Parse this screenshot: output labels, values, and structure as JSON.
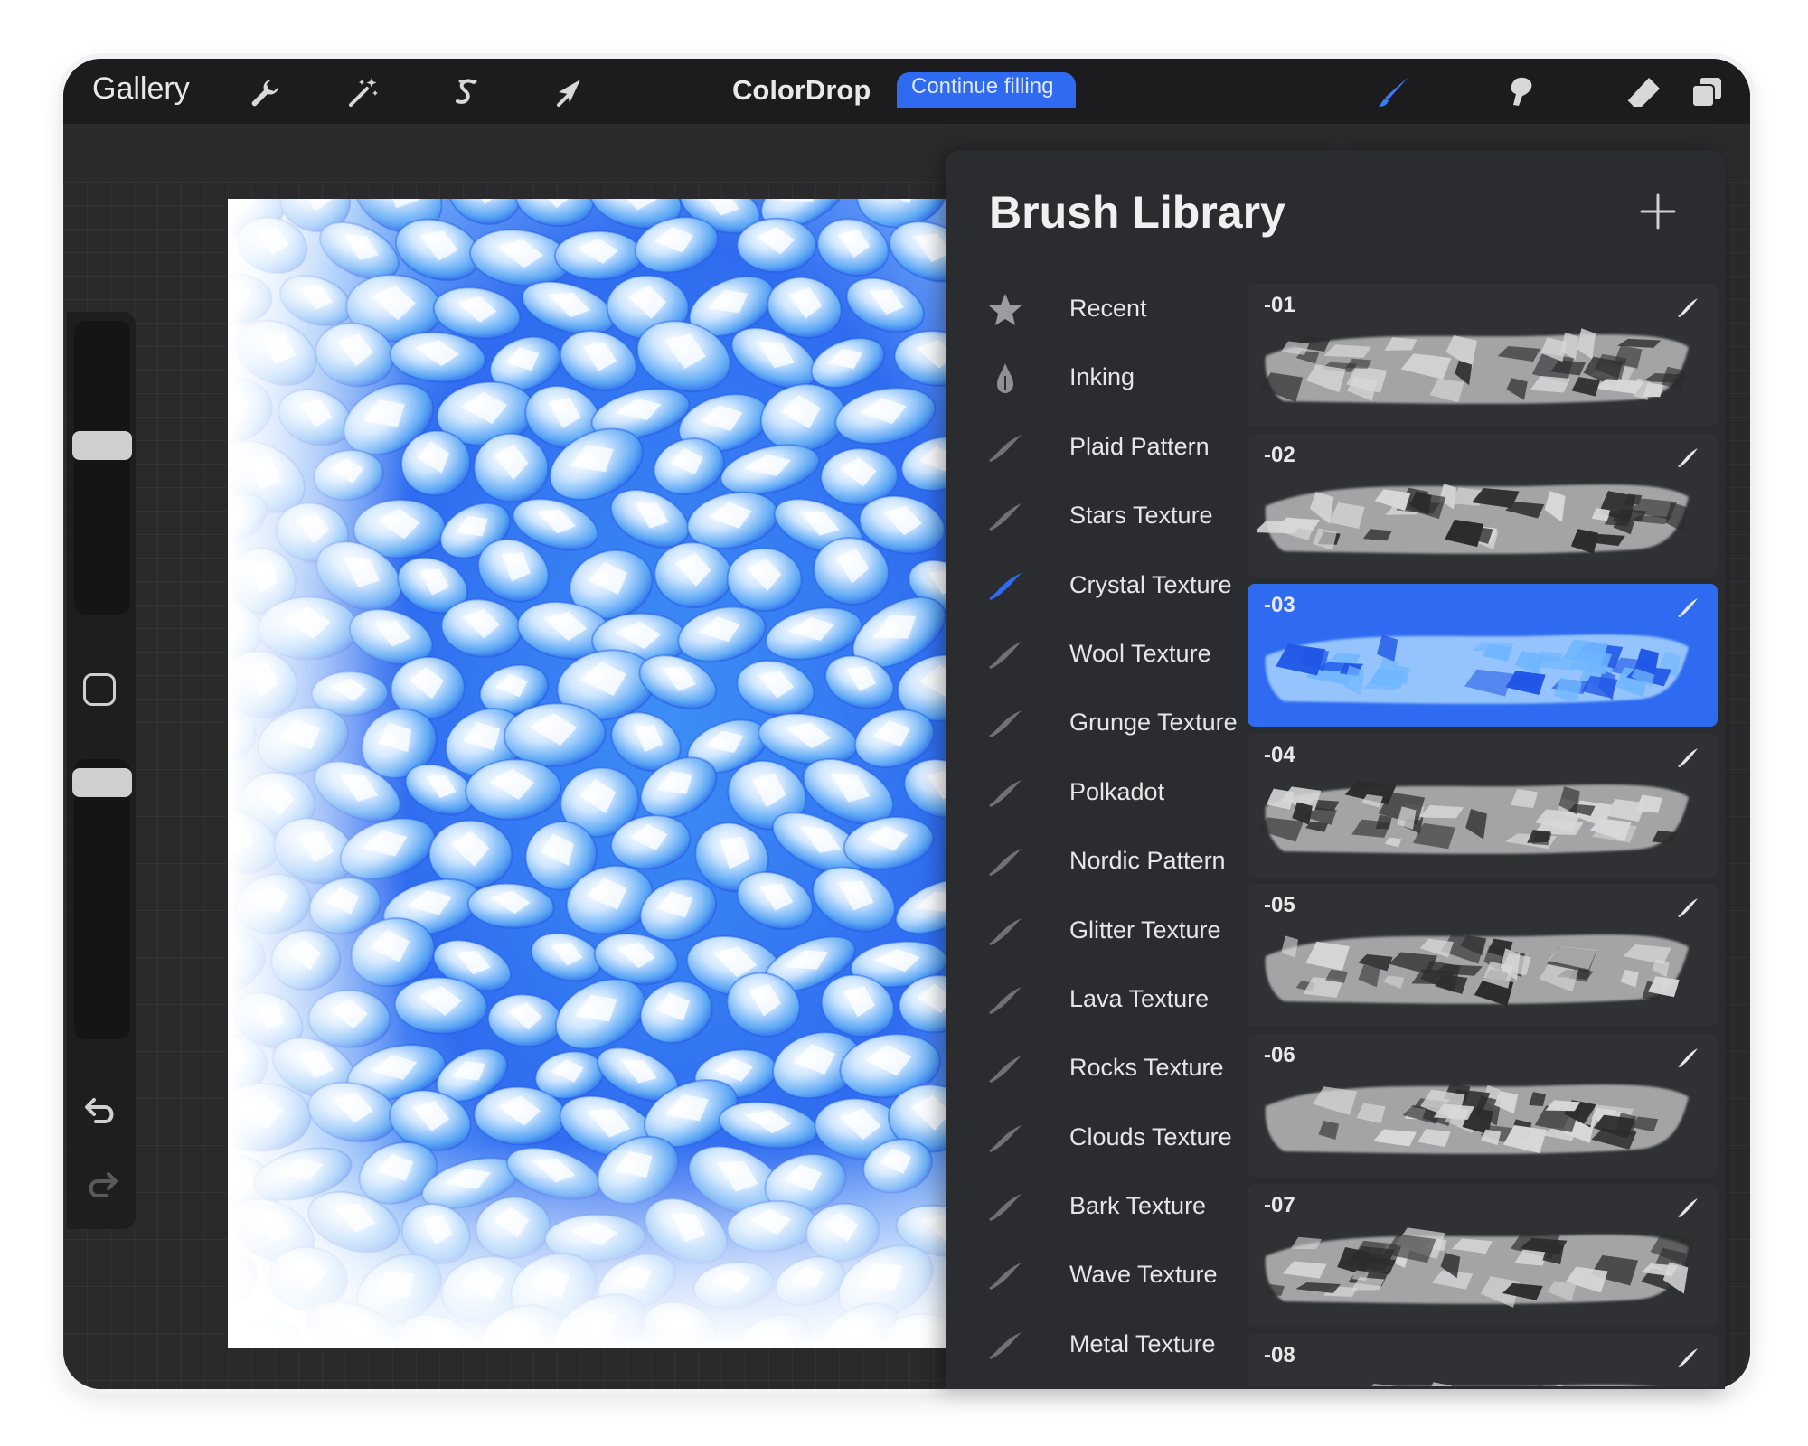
{
  "toolbar": {
    "gallery_label": "Gallery",
    "left_tools": [
      {
        "name": "actions",
        "icon": "wrench-icon"
      },
      {
        "name": "adjustments",
        "icon": "magic-wand-icon"
      },
      {
        "name": "selection",
        "icon": "selection-s-icon"
      },
      {
        "name": "transform",
        "icon": "arrow-cursor-icon"
      }
    ],
    "right_tools": [
      {
        "name": "paint",
        "icon": "brush-icon",
        "active": true
      },
      {
        "name": "smudge",
        "icon": "smudge-finger-icon",
        "active": false
      },
      {
        "name": "erase",
        "icon": "eraser-icon",
        "active": false
      },
      {
        "name": "layers",
        "icon": "layers-icon",
        "active": false
      }
    ]
  },
  "notification": {
    "title": "ColorDrop",
    "action_label": "Continue filling"
  },
  "brush_library": {
    "title": "Brush Library",
    "add_icon": "plus-icon",
    "sets": [
      {
        "label": "Recent",
        "icon": "star-icon"
      },
      {
        "label": "Inking",
        "icon": "ink-drop-icon"
      },
      {
        "label": "Plaid Pattern",
        "icon": "brush-stroke-icon"
      },
      {
        "label": "Stars Texture",
        "icon": "brush-stroke-icon"
      },
      {
        "label": "Crystal Texture",
        "icon": "brush-stroke-icon",
        "selected": true
      },
      {
        "label": "Wool Texture",
        "icon": "brush-stroke-icon"
      },
      {
        "label": "Grunge Texture",
        "icon": "brush-stroke-icon"
      },
      {
        "label": "Polkadot",
        "icon": "brush-stroke-icon"
      },
      {
        "label": "Nordic Pattern",
        "icon": "brush-stroke-icon"
      },
      {
        "label": "Glitter Texture",
        "icon": "brush-stroke-icon"
      },
      {
        "label": "Lava Texture",
        "icon": "brush-stroke-icon"
      },
      {
        "label": "Rocks Texture",
        "icon": "brush-stroke-icon"
      },
      {
        "label": "Clouds Texture",
        "icon": "brush-stroke-icon"
      },
      {
        "label": "Bark Texture",
        "icon": "brush-stroke-icon"
      },
      {
        "label": "Wave Texture",
        "icon": "brush-stroke-icon"
      },
      {
        "label": "Metal Texture",
        "icon": "brush-stroke-icon"
      }
    ],
    "brushes": [
      {
        "label": "-01",
        "selected": false
      },
      {
        "label": "-02",
        "selected": false
      },
      {
        "label": "-03",
        "selected": true
      },
      {
        "label": "-04",
        "selected": false
      },
      {
        "label": "-05",
        "selected": false
      },
      {
        "label": "-06",
        "selected": false
      },
      {
        "label": "-07",
        "selected": false
      },
      {
        "label": "-08",
        "selected": false
      }
    ]
  },
  "sidebar": {
    "undo_icon": "undo-icon",
    "redo_icon": "redo-icon",
    "modifier_icon": "square-modifier-icon"
  },
  "canvas": {
    "artwork": "blue crystal texture painting"
  },
  "colors": {
    "accent": "#2f6bf0",
    "toolbar_bg": "#1c1c1e",
    "panel_bg": "#2a2c2f",
    "crystal_dark": "#1f56e6",
    "crystal_mid": "#4aa8f2",
    "crystal_light": "#dcefff"
  }
}
